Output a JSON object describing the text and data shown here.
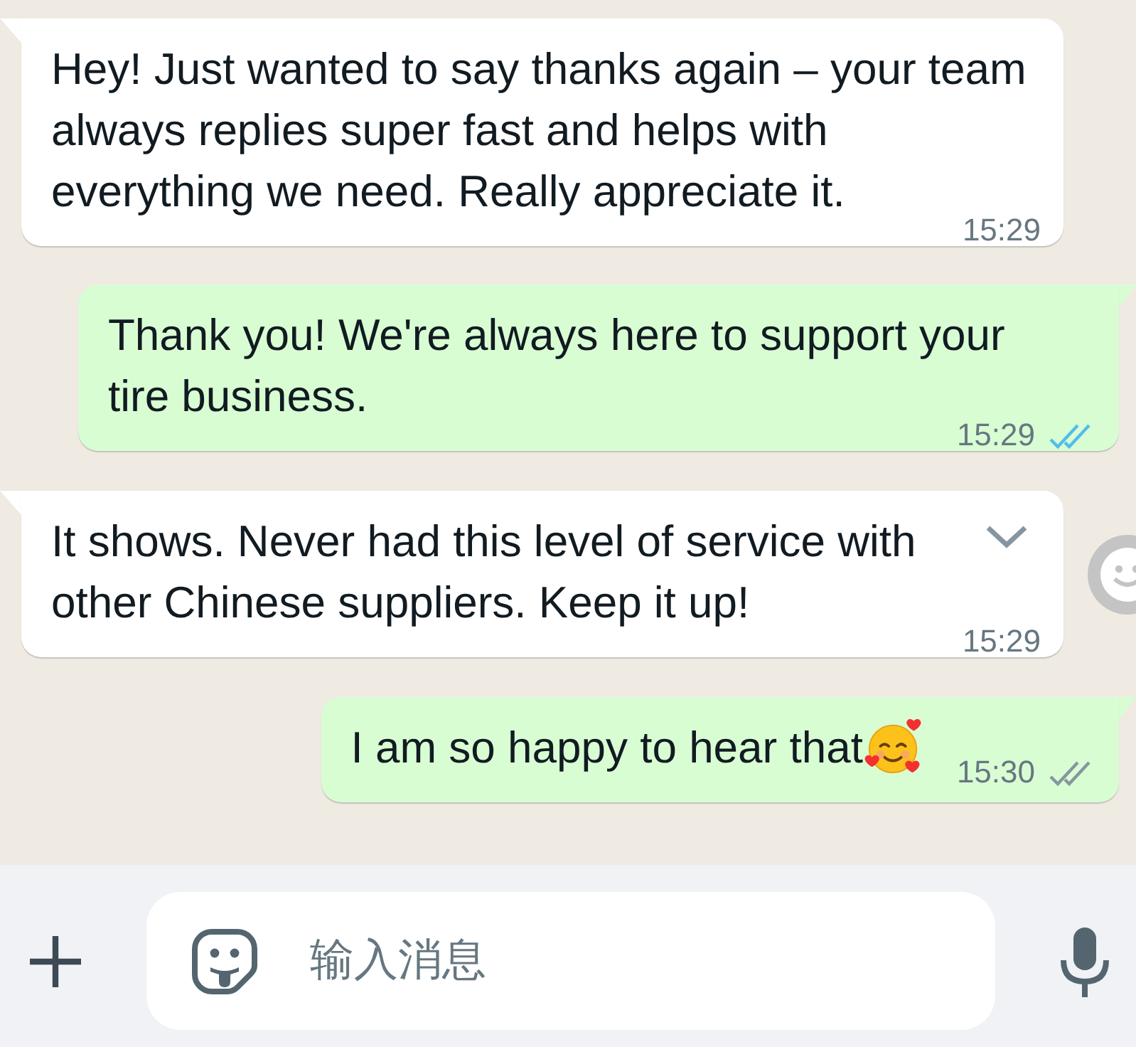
{
  "messages": [
    {
      "kind": "incoming",
      "text": "Hey! Just wanted to say thanks again – your team always replies super fast and helps with everything we need. Really appreciate it.",
      "time": "15:29",
      "tail": true
    },
    {
      "kind": "outgoing",
      "text": "Thank you! We're always here to support your tire business.",
      "time": "15:29",
      "read": true,
      "tail": true
    },
    {
      "kind": "incoming",
      "text": "It shows. Never had this level of service with other Chinese suppliers. Keep it up!",
      "time": "15:29",
      "tail": true,
      "hovered": true
    },
    {
      "kind": "outgoing",
      "text": "I am so happy to hear that",
      "trailing_emoji": true,
      "time": "15:30",
      "read": false,
      "tail": true
    }
  ],
  "composer": {
    "placeholder": "输入消息"
  }
}
